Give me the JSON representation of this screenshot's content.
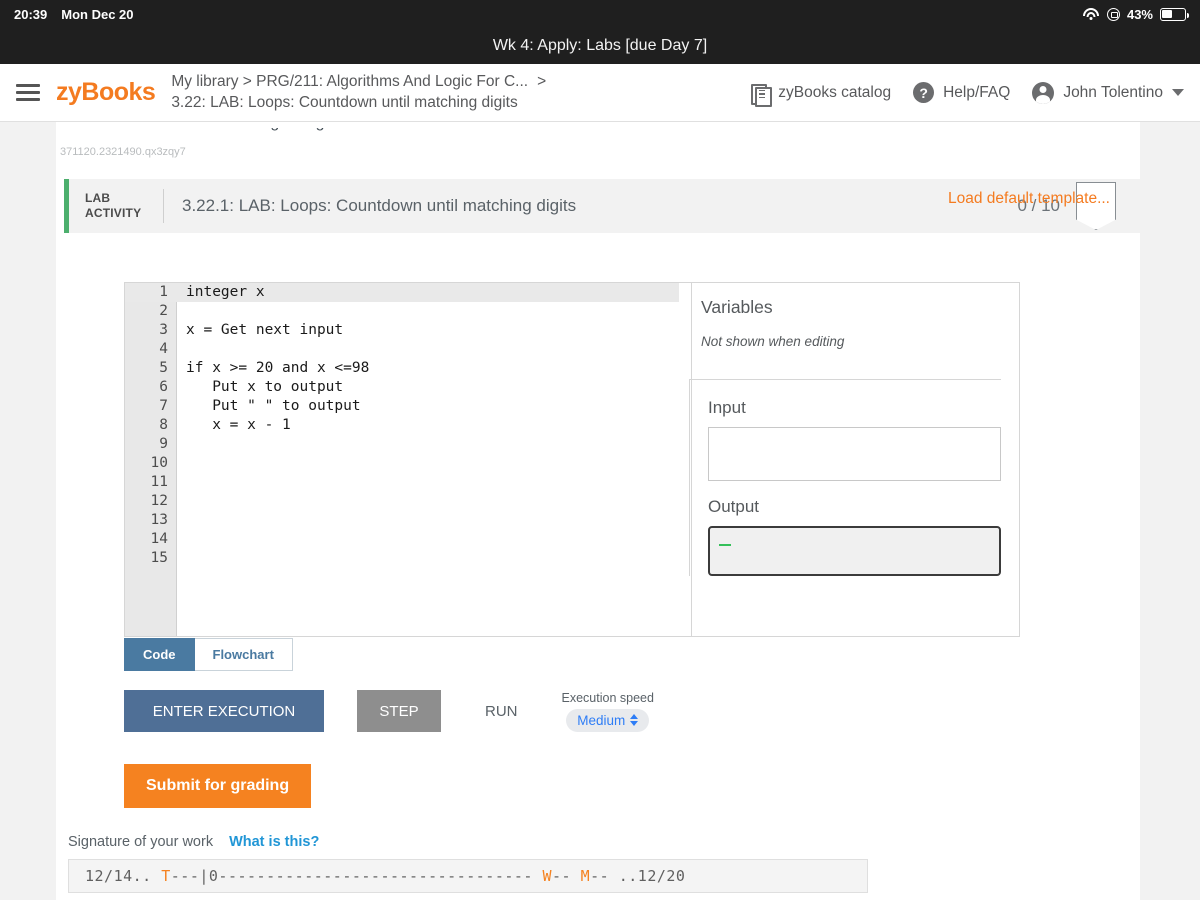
{
  "status_bar": {
    "time": "20:39",
    "date": "Mon Dec 20",
    "battery_percent": "43%",
    "icons": [
      "wifi-icon",
      "lock-rotation-icon",
      "battery-icon"
    ]
  },
  "window": {
    "title": "Wk 4: Apply: Labs [due Day 7]"
  },
  "topnav": {
    "menu_icon": "hamburger-menu-icon",
    "brand": "zyBooks",
    "breadcrumb_line1": "My library > PRG/211: Algorithms And Logic For C...",
    "breadcrumb_separator": ">",
    "breadcrumb_line2": "3.22: LAB: Loops: Countdown until matching digits",
    "catalog_label": "zyBooks catalog",
    "help_label": "Help/FAQ",
    "help_glyph": "?",
    "user_name": "John Tolentino"
  },
  "page": {
    "cut_off_text": "would be cumbersome for large ranges.",
    "activity_id": "371120.2321490.qx3zqy7"
  },
  "activity": {
    "tag_line1": "LAB",
    "tag_line2": "ACTIVITY",
    "title": "3.22.1: LAB: Loops: Countdown until matching digits",
    "score": "0 / 10",
    "accent_color": "#4caf6d",
    "load_template_label": "Load default template..."
  },
  "editor": {
    "lines": [
      {
        "num": "1",
        "text": "integer x"
      },
      {
        "num": "2",
        "text": ""
      },
      {
        "num": "3",
        "text": "x = Get next input"
      },
      {
        "num": "4",
        "text": ""
      },
      {
        "num": "5",
        "text": "if x >= 20 and x <=98"
      },
      {
        "num": "6",
        "text": "   Put x to output"
      },
      {
        "num": "7",
        "text": "   Put \" \" to output"
      },
      {
        "num": "8",
        "text": "   x = x - 1"
      },
      {
        "num": "9",
        "text": ""
      },
      {
        "num": "10",
        "text": ""
      },
      {
        "num": "11",
        "text": ""
      },
      {
        "num": "12",
        "text": ""
      },
      {
        "num": "13",
        "text": ""
      },
      {
        "num": "14",
        "text": ""
      },
      {
        "num": "15",
        "text": ""
      }
    ]
  },
  "side_panel": {
    "variables_title": "Variables",
    "variables_note": "Not shown when editing",
    "input_label": "Input",
    "input_value": "",
    "output_label": "Output",
    "output_value": ""
  },
  "tabs": [
    {
      "label": "Code",
      "active": true
    },
    {
      "label": "Flowchart",
      "active": false
    }
  ],
  "controls": {
    "enter_execution": "ENTER EXECUTION",
    "step": "STEP",
    "run": "RUN",
    "speed_label": "Execution speed",
    "speed_value": "Medium",
    "submit": "Submit for grading"
  },
  "signature": {
    "label": "Signature of your work",
    "link": "What is this?",
    "prefix": "12/14.. ",
    "mark_t": "T",
    "mid": "---|0--------------------------------- ",
    "mark_w": "W",
    "mark_w_tail": "-- ",
    "mark_m": "M",
    "mark_m_tail": "-- ",
    "suffix": "..12/20"
  }
}
